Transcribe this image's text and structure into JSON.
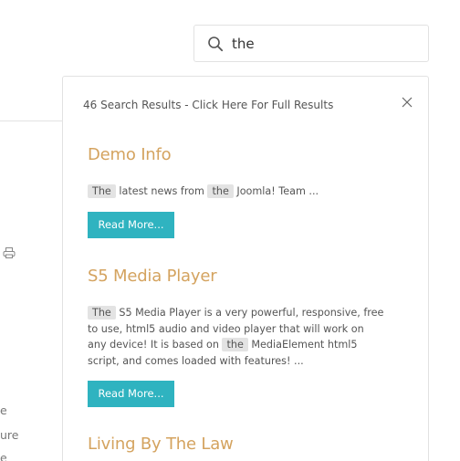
{
  "background": {
    "fragments": [
      "e",
      "ure",
      "e"
    ]
  },
  "search": {
    "value": "the",
    "icon": "search-icon"
  },
  "results": {
    "summary": "46 Search Results - Click Here For Full Results",
    "items": [
      {
        "title": "Demo Info",
        "snippet": [
          {
            "hl": "The"
          },
          {
            "text": " latest news from "
          },
          {
            "hl": "the"
          },
          {
            "text": " Joomla! Team  ..."
          }
        ],
        "button": "Read More..."
      },
      {
        "title": "S5 Media Player",
        "snippet": [
          {
            "hl": "The"
          },
          {
            "text": " S5 Media Player is a very powerful, responsive, free to use, html5 audio and video player that will work on any device! It is based on "
          },
          {
            "hl": "the"
          },
          {
            "text": " MediaElement html5 script, and comes loaded with features! ..."
          }
        ],
        "button": "Read More..."
      },
      {
        "title": "Living By The Law"
      }
    ]
  },
  "colors": {
    "title": "#d4a35f",
    "button": "#2fb3c0",
    "highlight": "#e3e3e3",
    "border": "#e2e2e2"
  }
}
